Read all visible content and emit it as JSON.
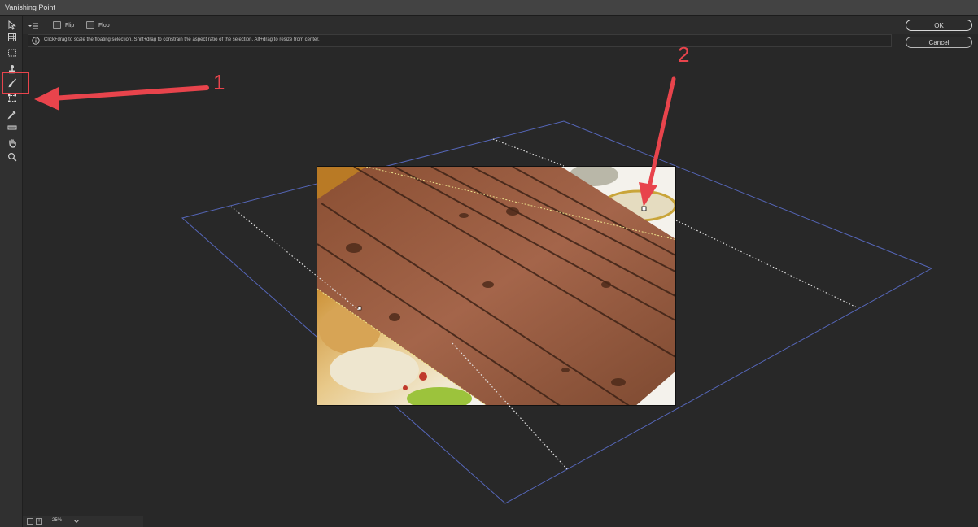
{
  "window": {
    "title": "Vanishing Point"
  },
  "options": {
    "flip_label": "Flip",
    "flop_label": "Flop",
    "info_message": "Click+drag to scale the floating selection. Shift+drag to constrain the aspect ratio of the selection. Alt+drag to resize from center."
  },
  "buttons": {
    "ok": "OK",
    "cancel": "Cancel"
  },
  "tools": [
    "edit-plane-tool-icon",
    "create-plane-tool-icon",
    "marquee-tool-icon",
    "stamp-tool-icon",
    "brush-tool-icon",
    "transform-tool-icon",
    "eyedropper-tool-icon",
    "measure-tool-icon",
    "hand-tool-icon",
    "zoom-tool-icon"
  ],
  "annotations": {
    "marker_1": "1",
    "marker_2": "2"
  },
  "zoom": {
    "value": "25%"
  },
  "colors": {
    "accent": "#e8444c",
    "plane_grid": "#5566b8",
    "background": "#282828"
  }
}
